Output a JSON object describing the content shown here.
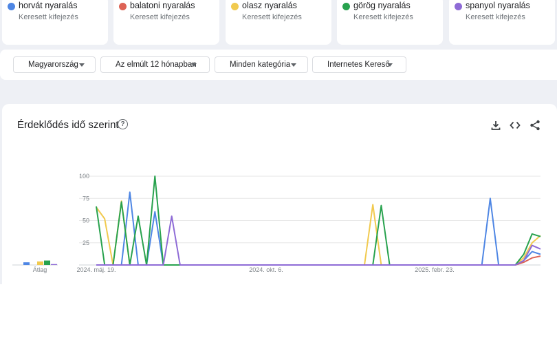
{
  "terms": [
    {
      "name": "horvát nyaralás",
      "type": "Keresett kifejezés",
      "color": "#4e86e4"
    },
    {
      "name": "balatoni nyaralás",
      "type": "Keresett kifejezés",
      "color": "#dd6355"
    },
    {
      "name": "olasz nyaralás",
      "type": "Keresett kifejezés",
      "color": "#f1ca4f"
    },
    {
      "name": "görög nyaralás",
      "type": "Keresett kifejezés",
      "color": "#28a24e"
    },
    {
      "name": "spanyol nyaralás",
      "type": "Keresett kifejezés",
      "color": "#8e6bd6"
    }
  ],
  "filters": {
    "region": "Magyarország",
    "period": "Az elmúlt 12 hónapban",
    "category": "Minden kategória",
    "search_type": "Internetes Kereső"
  },
  "panel": {
    "title": "Érdeklődés idő szerint",
    "help_icon": "help-circle-icon",
    "tools": [
      "download-icon",
      "embed-code-icon",
      "share-icon"
    ]
  },
  "chart_data": {
    "type": "line",
    "x_tick_labels": [
      "2024. máj. 19.",
      "2024. okt. 6.",
      "2025. febr. 23."
    ],
    "y_ticks": [
      25,
      50,
      75,
      100
    ],
    "ylim": [
      0,
      100
    ],
    "grid": true,
    "average_label": "Átlag",
    "averages": [
      3,
      0,
      4,
      5,
      1
    ],
    "series": [
      {
        "name": "horvát nyaralás",
        "color": "#4e86e4",
        "values": [
          0,
          0,
          0,
          0,
          82,
          0,
          0,
          60,
          0,
          0,
          0,
          0,
          0,
          0,
          0,
          0,
          0,
          0,
          0,
          0,
          0,
          0,
          0,
          0,
          0,
          0,
          0,
          0,
          0,
          0,
          0,
          0,
          0,
          0,
          0,
          0,
          0,
          0,
          0,
          0,
          0,
          0,
          0,
          0,
          0,
          0,
          0,
          75,
          0,
          0,
          0,
          5,
          15,
          12
        ]
      },
      {
        "name": "balatoni nyaralás",
        "color": "#dd6355",
        "values": [
          0,
          0,
          0,
          0,
          0,
          0,
          0,
          0,
          0,
          0,
          0,
          0,
          0,
          0,
          0,
          0,
          0,
          0,
          0,
          0,
          0,
          0,
          0,
          0,
          0,
          0,
          0,
          0,
          0,
          0,
          0,
          0,
          0,
          0,
          0,
          0,
          0,
          0,
          0,
          0,
          0,
          0,
          0,
          0,
          0,
          0,
          0,
          0,
          0,
          0,
          0,
          3,
          8,
          10
        ]
      },
      {
        "name": "olasz nyaralás",
        "color": "#f1ca4f",
        "values": [
          65,
          52,
          0,
          72,
          0,
          0,
          0,
          0,
          0,
          0,
          0,
          0,
          0,
          0,
          0,
          0,
          0,
          0,
          0,
          0,
          0,
          0,
          0,
          0,
          0,
          0,
          0,
          0,
          0,
          0,
          0,
          0,
          0,
          68,
          0,
          0,
          0,
          0,
          0,
          0,
          0,
          0,
          0,
          0,
          0,
          0,
          0,
          0,
          0,
          0,
          0,
          8,
          25,
          33
        ]
      },
      {
        "name": "görög nyaralás",
        "color": "#28a24e",
        "values": [
          66,
          0,
          0,
          71,
          0,
          55,
          0,
          100,
          0,
          0,
          0,
          0,
          0,
          0,
          0,
          0,
          0,
          0,
          0,
          0,
          0,
          0,
          0,
          0,
          0,
          0,
          0,
          0,
          0,
          0,
          0,
          0,
          0,
          0,
          67,
          0,
          0,
          0,
          0,
          0,
          0,
          0,
          0,
          0,
          0,
          0,
          0,
          0,
          0,
          0,
          0,
          12,
          35,
          32
        ]
      },
      {
        "name": "spanyol nyaralás",
        "color": "#8e6bd6",
        "values": [
          0,
          0,
          0,
          0,
          0,
          0,
          0,
          0,
          0,
          55,
          0,
          0,
          0,
          0,
          0,
          0,
          0,
          0,
          0,
          0,
          0,
          0,
          0,
          0,
          0,
          0,
          0,
          0,
          0,
          0,
          0,
          0,
          0,
          0,
          0,
          0,
          0,
          0,
          0,
          0,
          0,
          0,
          0,
          0,
          0,
          0,
          0,
          0,
          0,
          0,
          0,
          5,
          22,
          18
        ]
      }
    ]
  }
}
